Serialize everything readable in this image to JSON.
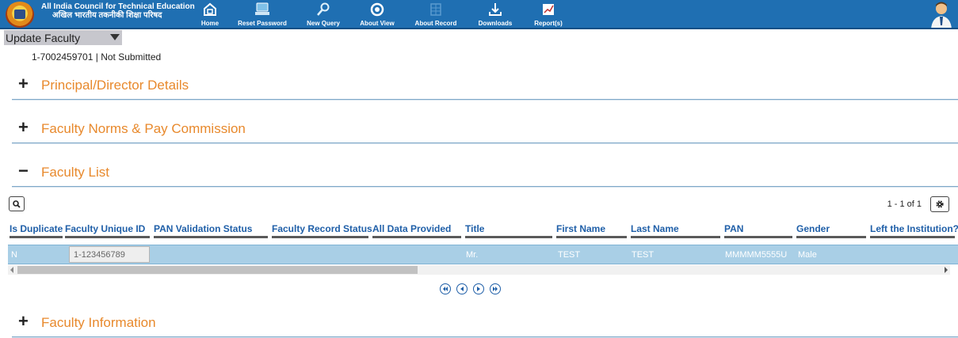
{
  "header": {
    "org_en": "All India Council for Technical Education",
    "org_hi": "अखिल भारतीय तकनीकी शिक्षा परिषद",
    "nav": [
      {
        "label": "Home",
        "icon": "home-icon"
      },
      {
        "label": "Reset Password",
        "icon": "reset-password-icon"
      },
      {
        "label": "New Query",
        "icon": "new-query-icon"
      },
      {
        "label": "About View",
        "icon": "about-view-icon"
      },
      {
        "label": "About Record",
        "icon": "about-record-icon"
      },
      {
        "label": "Downloads",
        "icon": "downloads-icon"
      },
      {
        "label": "Report(s)",
        "icon": "reports-icon"
      }
    ],
    "colors": {
      "bar": "#1f6fb2",
      "accent": "#e8892c",
      "link": "#1f5fa8"
    }
  },
  "view": {
    "title": "Update Faculty",
    "record_line": "1-7002459701 | Not Submitted"
  },
  "sections": [
    {
      "sign": "+",
      "title": "Principal/Director Details"
    },
    {
      "sign": "+",
      "title": "Faculty Norms & Pay Commission"
    },
    {
      "sign": "−",
      "title": "Faculty List"
    },
    {
      "sign": "+",
      "title": "Faculty Information"
    }
  ],
  "grid": {
    "page_info": "1 - 1 of 1",
    "columns": [
      "Is Duplicate",
      "Faculty Unique ID",
      "PAN Validation Status",
      "Faculty Record Status",
      "All Data Provided",
      "Title",
      "First Name",
      "Last Name",
      "PAN",
      "Gender",
      "Left the Institution?"
    ],
    "row": {
      "is_duplicate": "N",
      "faculty_unique_id": "1-123456789",
      "pan_validation_status": "",
      "faculty_record_status": "",
      "all_data_provided": "",
      "title": "Mr.",
      "first_name": "TEST",
      "last_name": "TEST",
      "pan": "MMMMM5555U",
      "gender": "Male",
      "left_institution": ""
    }
  }
}
